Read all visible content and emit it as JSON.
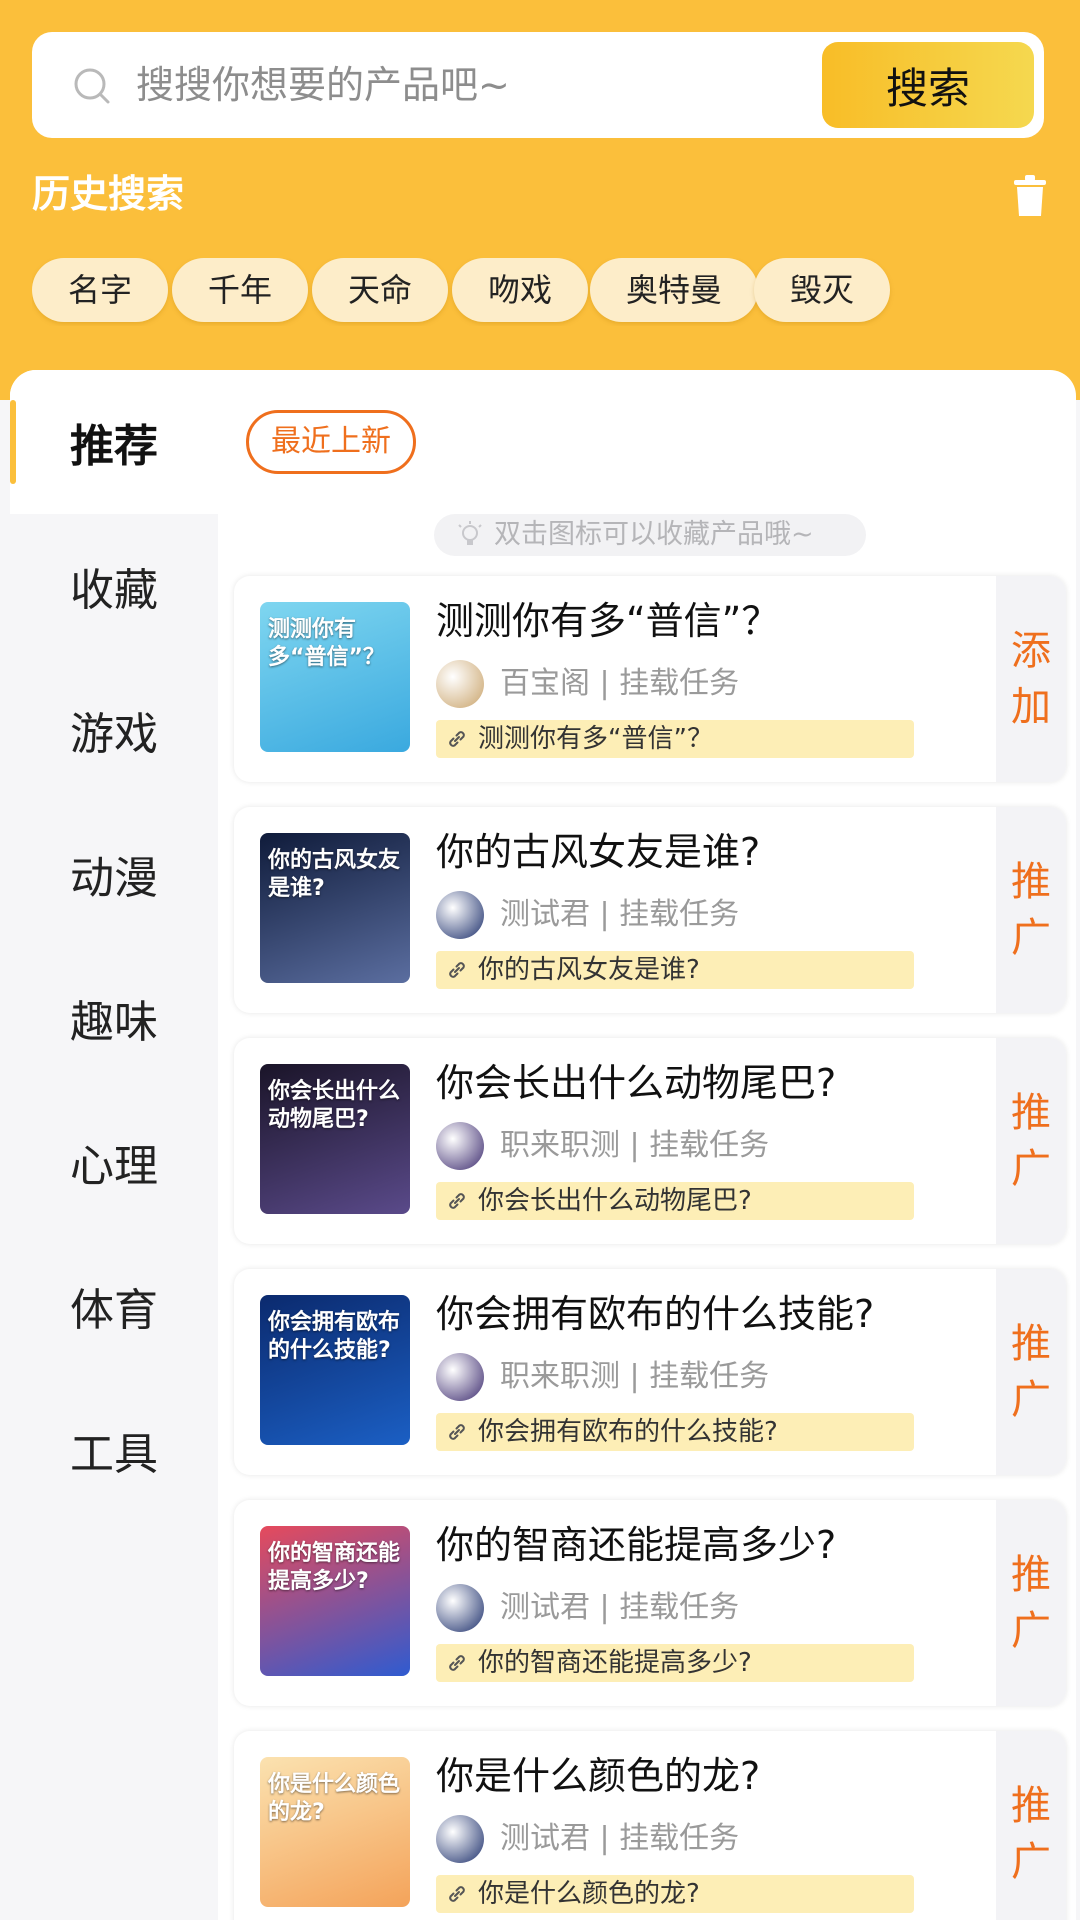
{
  "search": {
    "placeholder": "搜搜你想要的产品吧~",
    "button_label": "搜索"
  },
  "history": {
    "title": "历史搜索",
    "chips": [
      "名字",
      "千年",
      "天命",
      "吻戏",
      "奥特曼",
      "毁灭"
    ]
  },
  "sidebar": {
    "items": [
      {
        "label": "推荐",
        "active": true
      },
      {
        "label": "收藏"
      },
      {
        "label": "游戏"
      },
      {
        "label": "动漫"
      },
      {
        "label": "趣味"
      },
      {
        "label": "心理"
      },
      {
        "label": "体育"
      },
      {
        "label": "工具"
      }
    ]
  },
  "content": {
    "tab_label": "最近上新",
    "hint": "双击图标可以收藏产品哦~",
    "cards": [
      {
        "title": "测测你有多“普信”？",
        "source": "百宝阁 | 挂载任务",
        "link_text": "测测你有多“普信”？",
        "action": "添加",
        "thumb_text": "测测你有多“普信”？",
        "thumb_colors": [
          "#7fd6f0",
          "#3aa9df"
        ],
        "avatar_color": "#c9a36a"
      },
      {
        "title": "你的古风女友是谁?",
        "source": "测试君 | 挂载任务",
        "link_text": "你的古风女友是谁?",
        "action": "推广",
        "thumb_text": "你的古风女友是谁?",
        "thumb_colors": [
          "#0f1b3a",
          "#5b6ea0"
        ],
        "avatar_color": "#1b2e6b"
      },
      {
        "title": "你会长出什么动物尾巴?",
        "source": "职来职测 | 挂载任务",
        "link_text": "你会长出什么动物尾巴?",
        "action": "推广",
        "thumb_text": "你会长出什么动物尾巴?",
        "thumb_colors": [
          "#1a1428",
          "#5a4a8a"
        ],
        "avatar_color": "#3b2a6e"
      },
      {
        "title": "你会拥有欧布的什么技能?",
        "source": "职来职测 | 挂载任务",
        "link_text": "你会拥有欧布的什么技能?",
        "action": "推广",
        "thumb_text": "你会拥有欧布的什么技能?",
        "thumb_colors": [
          "#0b2a6e",
          "#1b5fc4"
        ],
        "avatar_color": "#3b2a6e"
      },
      {
        "title": "你的智商还能提高多少?",
        "source": "测试君 | 挂载任务",
        "link_text": "你的智商还能提高多少?",
        "action": "推广",
        "thumb_text": "你的智商还能提高多少?",
        "thumb_colors": [
          "#e64a5c",
          "#2f5bd0"
        ],
        "avatar_color": "#1b2e6b"
      },
      {
        "title": "你是什么颜色的龙?",
        "source": "测试君 | 挂载任务",
        "link_text": "你是什么颜色的龙?",
        "action": "推广",
        "thumb_text": "你是什么颜色的龙?",
        "thumb_colors": [
          "#fbe2b0",
          "#f4a35a"
        ],
        "avatar_color": "#1b2e6b"
      }
    ]
  },
  "colors": {
    "brand": "#fbbf3b",
    "accent": "#ef6f1d"
  }
}
